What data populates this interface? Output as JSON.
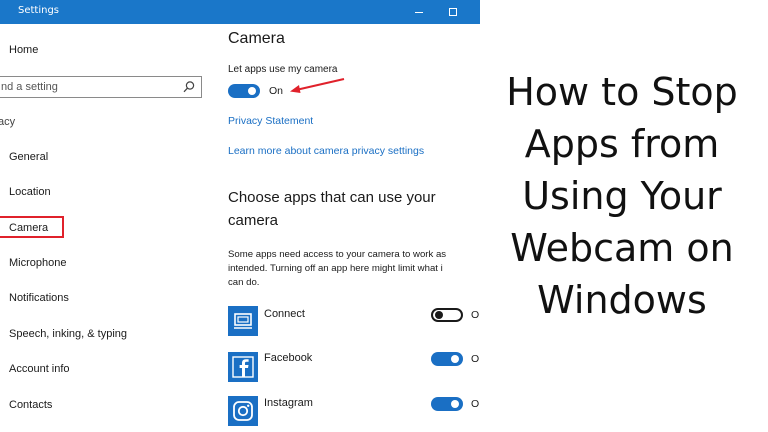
{
  "window": {
    "title": "Settings"
  },
  "sidebar": {
    "home_label": "Home",
    "search_placeholder": "nd a setting",
    "section_label": "acy",
    "items": [
      {
        "label": "General"
      },
      {
        "label": "Location"
      },
      {
        "label": "Camera",
        "selected": true
      },
      {
        "label": "Microphone"
      },
      {
        "label": "Notifications"
      },
      {
        "label": "Speech, inking, & typing"
      },
      {
        "label": "Account info"
      },
      {
        "label": "Contacts"
      }
    ]
  },
  "main": {
    "heading": "Camera",
    "allow_label": "Let apps use my camera",
    "allow_state_label": "On",
    "allow_on": true,
    "privacy_link": "Privacy Statement",
    "learn_more_link": "Learn more about camera privacy settings",
    "choose_heading_line1": "Choose apps that can use your",
    "choose_heading_line2": "camera",
    "description_line1": "Some apps need access to your camera to work as",
    "description_line2": "intended. Turning off an app here might limit what i",
    "description_line3": "can do.",
    "apps": [
      {
        "name": "Connect",
        "on": false,
        "state_trunc": "O",
        "icon": "connect-icon"
      },
      {
        "name": "Facebook",
        "on": true,
        "state_trunc": "O",
        "icon": "facebook-icon"
      },
      {
        "name": "Instagram",
        "on": true,
        "state_trunc": "O",
        "icon": "instagram-icon"
      }
    ]
  },
  "headline": {
    "lines": [
      "How to Stop",
      "Apps from",
      "Using Your",
      "Webcam on",
      "Windows"
    ]
  },
  "colors": {
    "titlebar": "#1a77c9",
    "accent": "#1a6fc4",
    "highlight_box": "#e0212b",
    "arrow": "#e0212b"
  }
}
